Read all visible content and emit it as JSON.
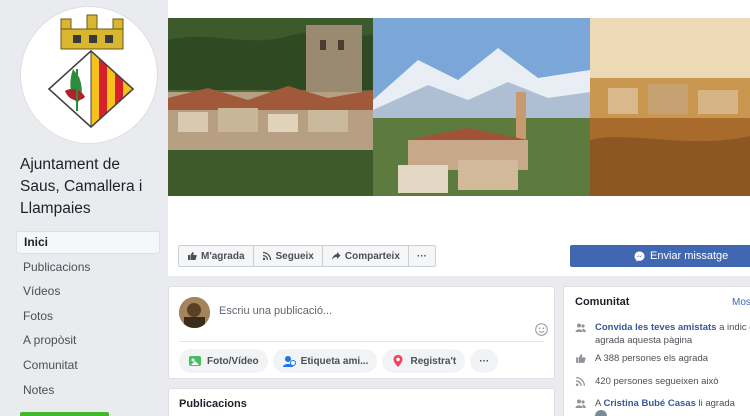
{
  "page": {
    "name": "Ajuntament de Saus, Camallera i Llampaies"
  },
  "nav": [
    {
      "label": "Inici",
      "active": true
    },
    {
      "label": "Publicacions"
    },
    {
      "label": "Vídeos"
    },
    {
      "label": "Fotos"
    },
    {
      "label": "A propòsit"
    },
    {
      "label": "Comunitat"
    },
    {
      "label": "Notes"
    }
  ],
  "actions": {
    "like": "M'agrada",
    "follow": "Segueix",
    "share": "Comparteix",
    "more": "···"
  },
  "send_message": "Enviar missatge",
  "composer": {
    "placeholder": "Escriu una publicació...",
    "photo_video": "Foto/Vídeo",
    "tag_friends": "Etiqueta ami...",
    "checkin": "Registra't",
    "more": "···"
  },
  "publications": {
    "title": "Publicacions"
  },
  "community": {
    "title": "Comunitat",
    "more": "Mos",
    "invite_link": "Convida les teves amistats",
    "invite_rest": " a indic els agrada aquesta pàgina",
    "likes": "A 388 persones els agrada",
    "follows": "420 persones segueixen això",
    "friend_prefix": "A ",
    "friend_name": "Cristina Bubé Casas",
    "friend_suffix": " li agrada"
  },
  "colors": {
    "brand": "#4267b2",
    "link": "#365899",
    "background": "#e9ebee"
  }
}
